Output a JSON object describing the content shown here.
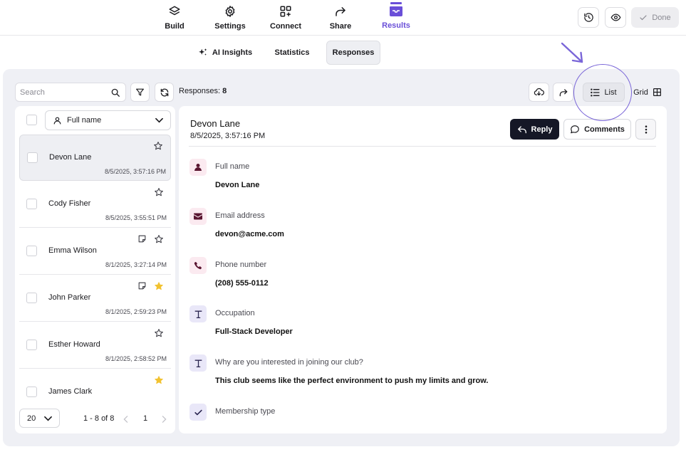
{
  "nav": {
    "items": [
      {
        "label": "Build",
        "icon": "layers-icon"
      },
      {
        "label": "Settings",
        "icon": "gear-icon"
      },
      {
        "label": "Connect",
        "icon": "apps-plus-icon"
      },
      {
        "label": "Share",
        "icon": "share-arrow-icon"
      },
      {
        "label": "Results",
        "icon": "inbox-icon",
        "active": true
      }
    ],
    "done_label": "Done",
    "accent": "#6a4fd8"
  },
  "subtabs": [
    {
      "label": "AI Insights",
      "icon": "sparkles-icon"
    },
    {
      "label": "Statistics"
    },
    {
      "label": "Responses",
      "active": true
    }
  ],
  "toolbar": {
    "search_placeholder": "Search",
    "responses_label": "Responses:",
    "responses_count": "8",
    "list_label": "List",
    "grid_label": "Grid"
  },
  "list": {
    "field_select": "Full name",
    "rows": [
      {
        "name": "Devon Lane",
        "date": "8/5/2025, 3:57:16 PM",
        "starred": false,
        "note": false,
        "selected": true
      },
      {
        "name": "Cody Fisher",
        "date": "8/5/2025, 3:55:51 PM",
        "starred": false,
        "note": false
      },
      {
        "name": "Emma Wilson",
        "date": "8/1/2025, 3:27:14 PM",
        "starred": false,
        "note": true
      },
      {
        "name": "John Parker",
        "date": "8/1/2025, 2:59:23 PM",
        "starred": true,
        "note": true
      },
      {
        "name": "Esther Howard",
        "date": "8/1/2025, 2:58:52 PM",
        "starred": false,
        "note": false
      },
      {
        "name": "James Clark",
        "date": "",
        "starred": true,
        "note": false
      }
    ],
    "page_size": "20",
    "range": "1 - 8 of 8",
    "page": "1"
  },
  "detail": {
    "name": "Devon Lane",
    "date": "8/5/2025, 3:57:16 PM",
    "reply_label": "Reply",
    "comments_label": "Comments",
    "fields": [
      {
        "label": "Full name",
        "value": "Devon Lane",
        "icon": "person-icon"
      },
      {
        "label": "Email address",
        "value": "devon@acme.com",
        "icon": "envelope-icon"
      },
      {
        "label": "Phone number",
        "value": "(208) 555-0112",
        "icon": "phone-icon"
      },
      {
        "label": "Occupation",
        "value": "Full-Stack Developer",
        "icon": "text-t-icon"
      },
      {
        "label": "Why are you interested in joining our club?",
        "value": "This club seems like the perfect environment to push my limits and grow.",
        "icon": "text-t-icon"
      },
      {
        "label": "Membership type",
        "value": "",
        "icon": "checkmark-icon"
      }
    ]
  }
}
